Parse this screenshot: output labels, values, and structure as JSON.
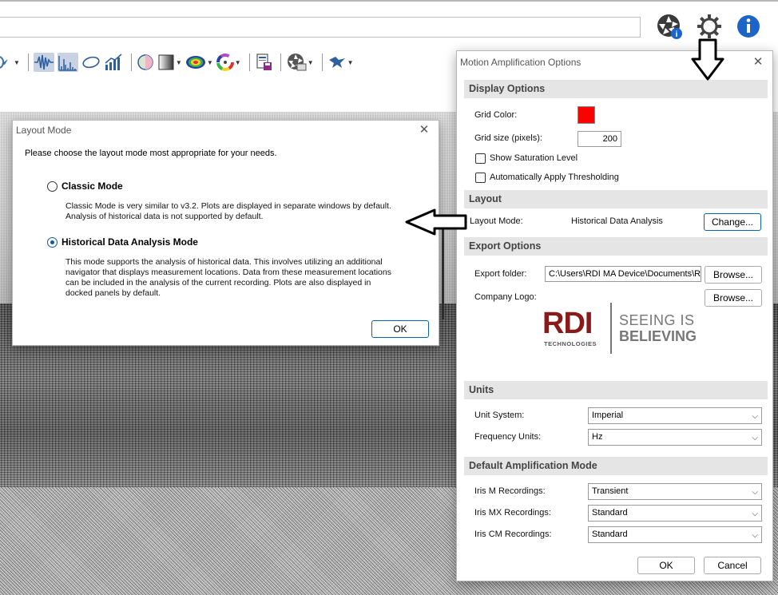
{
  "layout_dialog": {
    "title": "Layout Mode",
    "intro": "Please choose the layout mode most appropriate for your needs.",
    "options": [
      {
        "label": "Classic Mode",
        "selected": false,
        "desc_lines": [
          "Classic Mode is very similar to v3.2.  Plots are displayed in separate windows by default.",
          "Analysis of historical data is not supported by default."
        ]
      },
      {
        "label": "Historical Data Analysis Mode",
        "selected": true,
        "desc_lines": [
          "This mode supports the analysis of historical data.  This involves utilizing an additional",
          "navigator that displays measurement locations.  Data from these measurement locations",
          "can be included in the analysis of the current recording.  Plots are also displayed in",
          "docked panels by default."
        ]
      }
    ],
    "ok_label": "OK",
    "close_glyph": "✕"
  },
  "options_dialog": {
    "title": "Motion Amplification Options",
    "close_glyph": "✕",
    "display": {
      "header": "Display Options",
      "grid_color_label": "Grid Color:",
      "grid_color": "#ff0000",
      "grid_size_label": "Grid size (pixels):",
      "grid_size_value": "200",
      "show_saturation_label": "Show Saturation Level",
      "auto_threshold_label": "Automatically Apply Thresholding"
    },
    "layout": {
      "header": "Layout",
      "mode_label": "Layout Mode:",
      "mode_value": "Historical Data Analysis",
      "change_label": "Change..."
    },
    "export": {
      "header": "Export Options",
      "folder_label": "Export folder:",
      "folder_value": "C:\\Users\\RDI MA Device\\Documents\\R",
      "browse_label": "Browse...",
      "logo_label": "Company Logo:",
      "browse2_label": "Browse...",
      "logo_text": {
        "brand": "RDI",
        "sub": "TECHNOLOGIES",
        "tag1": "SEEING IS",
        "tag2": "BELIEVING"
      }
    },
    "units": {
      "header": "Units",
      "unit_system_label": "Unit System:",
      "unit_system_value": "Imperial",
      "freq_units_label": "Frequency Units:",
      "freq_units_value": "Hz"
    },
    "amplification": {
      "header": "Default Amplification Mode",
      "iris_m_label": "Iris M Recordings:",
      "iris_m_value": "Transient",
      "iris_mx_label": "Iris MX Recordings:",
      "iris_mx_value": "Standard",
      "iris_cm_label": "Iris CM Recordings:",
      "iris_cm_value": "Standard"
    },
    "ok_label": "OK",
    "cancel_label": "Cancel"
  },
  "colors": {
    "accent_blue": "#0a5aa8",
    "brand_red": "#8a1a1a",
    "crosshair_green": "#6fd12d",
    "info_blue": "#1d64c9"
  }
}
